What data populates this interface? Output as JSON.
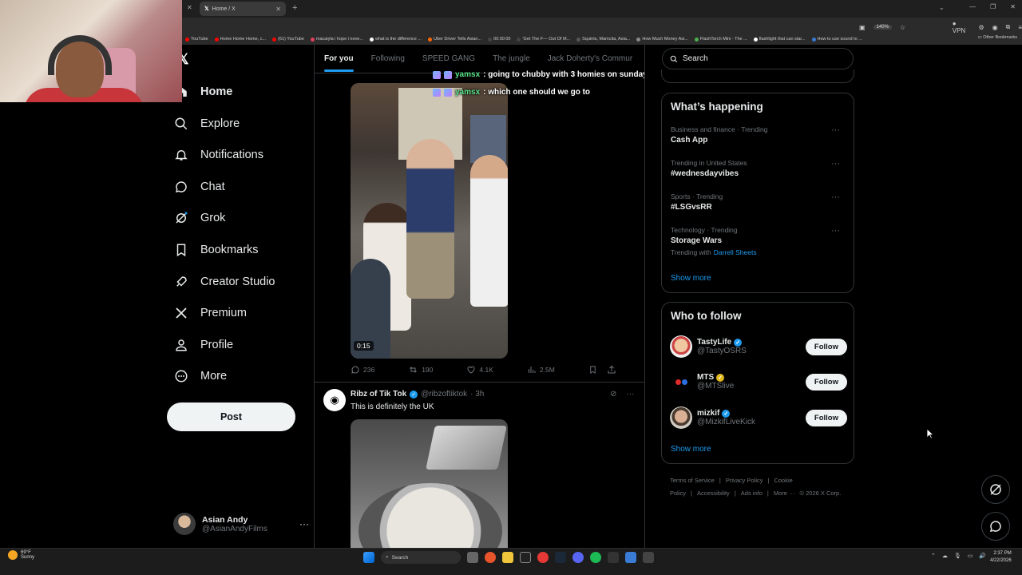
{
  "browser": {
    "tab_title": "Home / X",
    "zoom_level": "140%",
    "vpn_label": "VPN",
    "bookmarks": [
      "YouTube",
      "Home Home Home, c...",
      "(61) YouTube",
      "macaiyla i hope i neve...",
      "what is the difference ...",
      "Uber Driver Tells Asian...",
      "00:00:00",
      "'Get The F— Out Of M...",
      "Squints, Mamcita, Asia...",
      "How Much Money Asi...",
      "FlashTorch Mini - The ...",
      "flashlight that can star...",
      "How to use sound to ..."
    ],
    "other_bookmarks": "Other Bookmarks"
  },
  "nav": {
    "items": [
      {
        "label": "Home",
        "icon": "home-icon"
      },
      {
        "label": "Explore",
        "icon": "search-icon"
      },
      {
        "label": "Notifications",
        "icon": "bell-icon"
      },
      {
        "label": "Chat",
        "icon": "chat-icon"
      },
      {
        "label": "Grok",
        "icon": "grok-icon"
      },
      {
        "label": "Bookmarks",
        "icon": "bookmark-icon"
      },
      {
        "label": "Creator Studio",
        "icon": "rocket-icon"
      },
      {
        "label": "Premium",
        "icon": "x-icon"
      },
      {
        "label": "Profile",
        "icon": "person-icon"
      },
      {
        "label": "More",
        "icon": "more-circle-icon"
      }
    ],
    "post_label": "Post"
  },
  "account": {
    "name": "Asian Andy",
    "handle": "@AsianAndyFilms"
  },
  "feed": {
    "tabs": [
      "For you",
      "Following",
      "SPEED GANG",
      "The jungle",
      "Jack Doherty's Commur"
    ],
    "chat_overlay": [
      {
        "user": "yamsx",
        "message": ": going to chubby with 3 homies on sunday"
      },
      {
        "user": "yamsx",
        "message": ": which one should we go to"
      }
    ],
    "tweet1": {
      "duration": "0:15",
      "replies": "236",
      "reposts": "190",
      "likes": "4.1K",
      "views": "2.5M"
    },
    "tweet2": {
      "name": "Ribz of Tik Tok",
      "handle": "@ribzoftiktok",
      "time": "· 3h",
      "text": "This is definitely the UK"
    }
  },
  "sidebar_right": {
    "search_placeholder": "Search",
    "happening_title": "What’s happening",
    "trends": [
      {
        "category": "Business and finance · Trending",
        "topic": "Cash App"
      },
      {
        "category": "Trending in United States",
        "topic": "#wednesdayvibes"
      },
      {
        "category": "Sports · Trending",
        "topic": "#LSGvsRR"
      },
      {
        "category": "Technology · Trending",
        "topic": "Storage Wars",
        "with_label": "Trending with",
        "with_link": "Darrell Sheets"
      }
    ],
    "show_more": "Show more",
    "who_title": "Who to follow",
    "follow": [
      {
        "name": "TastyLife",
        "handle": "@TastyOSRS",
        "button": "Follow"
      },
      {
        "name": "MTS",
        "handle": "@MTSlive",
        "button": "Follow"
      },
      {
        "name": "mizkif",
        "handle": "@MizkifLiveKick",
        "button": "Follow"
      }
    ],
    "footer": [
      "Terms of Service",
      "|",
      "Privacy Policy",
      "|",
      "Cookie Policy",
      "|",
      "Accessibility",
      "|",
      "Ads info",
      "|",
      "More ···",
      "© 2026 X Corp."
    ]
  },
  "taskbar": {
    "weather_temp": "69°F",
    "weather_desc": "Sunny",
    "search_label": "Search",
    "time": "2:37 PM",
    "date": "4/22/2026"
  },
  "colors": {
    "accent": "#1d9bf0",
    "chat_user": "#5ae38a",
    "gold_check": "#e2b719"
  }
}
